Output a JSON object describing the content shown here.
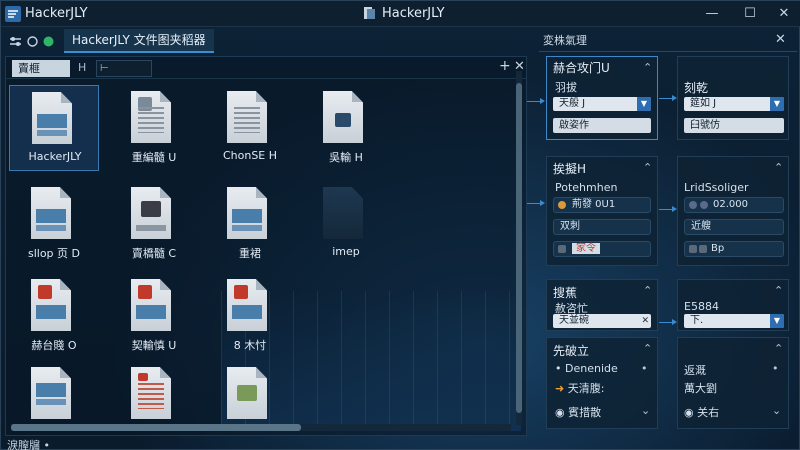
{
  "window": {
    "title": "HackerJLY",
    "center_title": "HackerJLY",
    "minimize": "—",
    "maximize": "☐",
    "close": "✕"
  },
  "toolbar": {
    "active_tab": "HackerJLY  文件图夹稻器"
  },
  "file_pane": {
    "tab_label": "賣榧",
    "tab2_label": "H",
    "path_value": "⊢",
    "files": [
      {
        "name": "HackerJLY",
        "kind": "blue-doc",
        "selected": true
      },
      {
        "name": "重編髓 U",
        "kind": "text-doc",
        "selected": false
      },
      {
        "name": "ChonSE H",
        "kind": "text-doc",
        "selected": false
      },
      {
        "name": "吳輸 H",
        "kind": "lock-doc",
        "selected": false
      },
      {
        "name": "sllop 页 D",
        "kind": "blue-doc",
        "selected": false
      },
      {
        "name": "賣橋髓 C",
        "kind": "img-doc",
        "selected": false
      },
      {
        "name": "重裙",
        "kind": "blue-doc",
        "selected": false
      },
      {
        "name": "imep",
        "kind": "dark-doc",
        "selected": false
      },
      {
        "name": "赫台賤 O",
        "kind": "red-doc",
        "selected": false
      },
      {
        "name": "契輸慎 U",
        "kind": "red-doc",
        "selected": false
      },
      {
        "name": "8 木忖",
        "kind": "red-doc",
        "selected": false
      },
      {
        "name": "",
        "kind": "blue-doc",
        "selected": false
      },
      {
        "name": "",
        "kind": "sheet-doc",
        "selected": false
      },
      {
        "name": "",
        "kind": "box-doc",
        "selected": false
      }
    ]
  },
  "status_bar": {
    "text": "淚膣牖  •"
  },
  "right_panel": {
    "title": "変株氣理",
    "close": "✕",
    "cards": {
      "c1": {
        "title": "赫合攻门U",
        "label": "羽拔",
        "select": "天般 J",
        "row": "啟姿作"
      },
      "c2": {
        "title": "刻乾",
        "select": "筵如 J",
        "row": "臼號仿"
      },
      "c3": {
        "title": "挨擬H",
        "label": "Potehmhen",
        "field": "荊發 0U1",
        "label2": "双刺",
        "field2": "家令"
      },
      "c4": {
        "label": "LridSsoliger",
        "field": "02.000",
        "label2": "近艘",
        "field2": "Bp"
      },
      "c5": {
        "title": "搜蕉",
        "label": "赦咨忙",
        "select": "天並碗"
      },
      "c6": {
        "label": "E5884",
        "select": "下."
      },
      "c7": {
        "title": "先破立",
        "row1": "Denenide",
        "row2": "天清腹:",
        "row3": "賓措散"
      },
      "c8": {
        "row1": "返溉",
        "row2": "萬大劉",
        "row3": "关右"
      }
    }
  },
  "colors": {
    "accent": "#3a8fd0",
    "background": "#0a1b2c",
    "card": "#0e2234"
  }
}
